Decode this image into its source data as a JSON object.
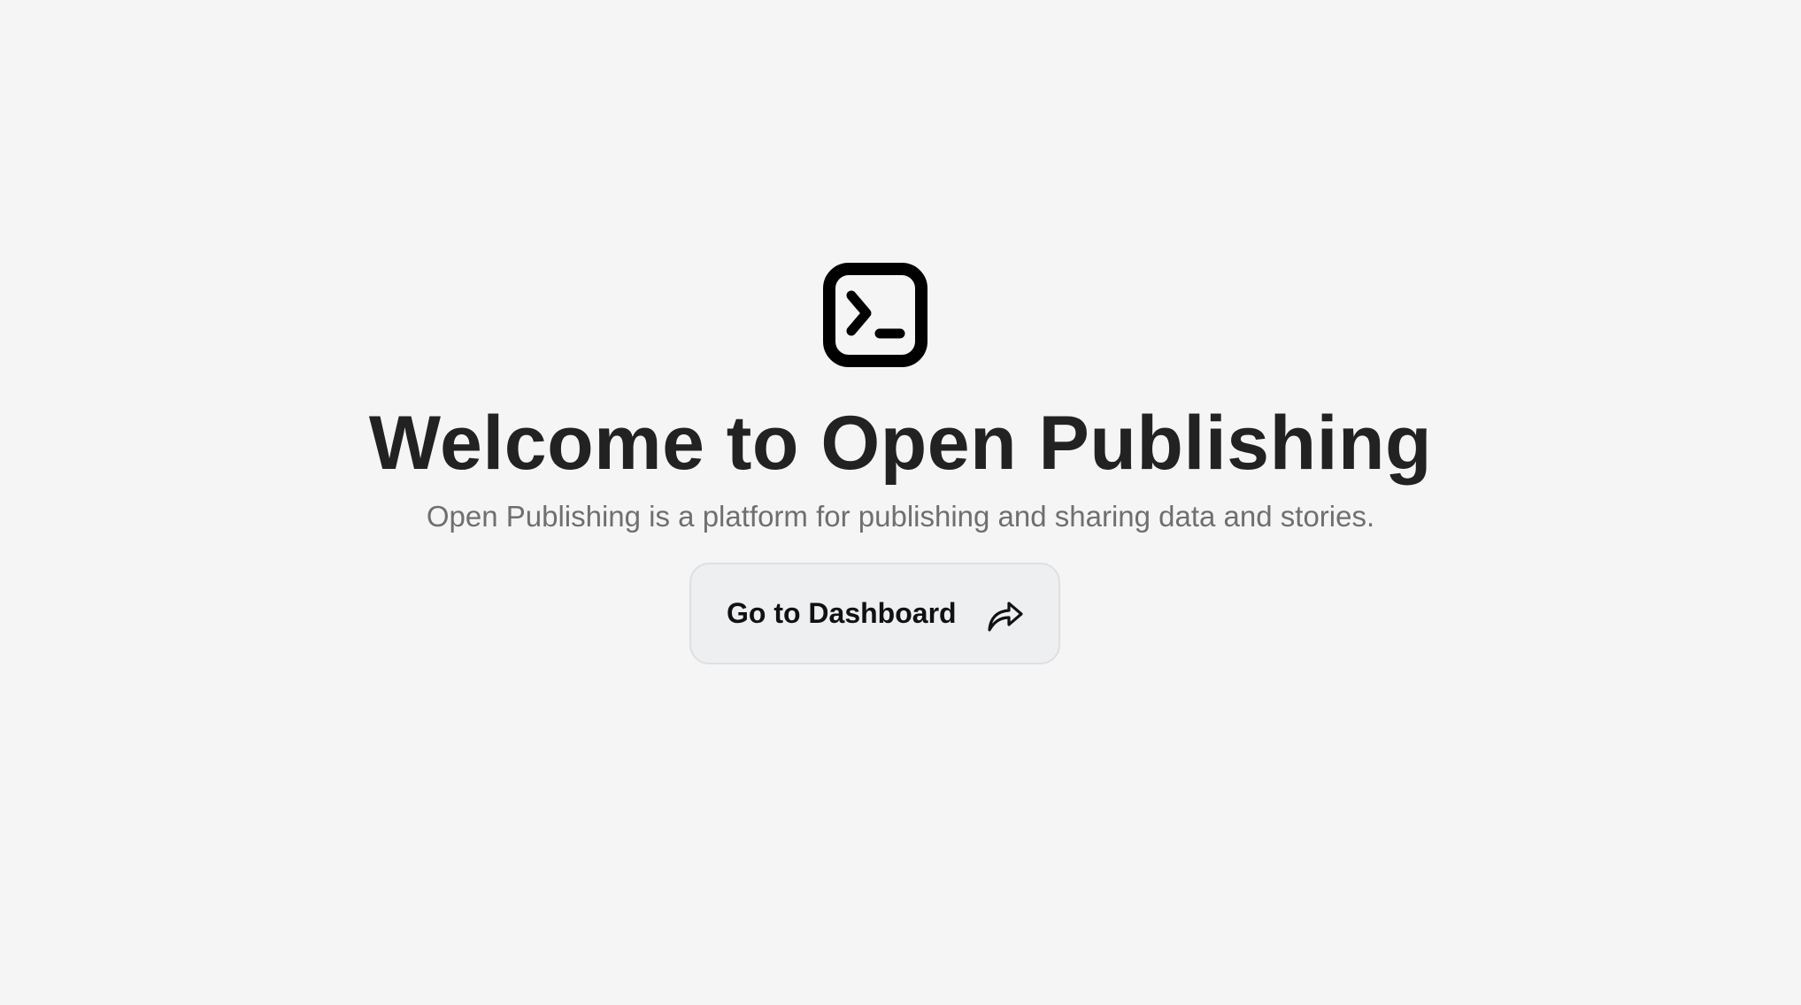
{
  "hero": {
    "logo_icon": "terminal-icon",
    "title": "Welcome to Open Publishing",
    "subtitle": "Open Publishing is a platform for publishing and sharing data and stories."
  },
  "cta": {
    "label": "Go to Dashboard",
    "icon": "share-forward-icon"
  },
  "colors": {
    "background": "#f5f5f5",
    "title": "#222222",
    "subtitle": "#6f6f6f",
    "button_bg": "#eeeff1",
    "button_border": "#dedfe2",
    "button_text": "#111111"
  }
}
